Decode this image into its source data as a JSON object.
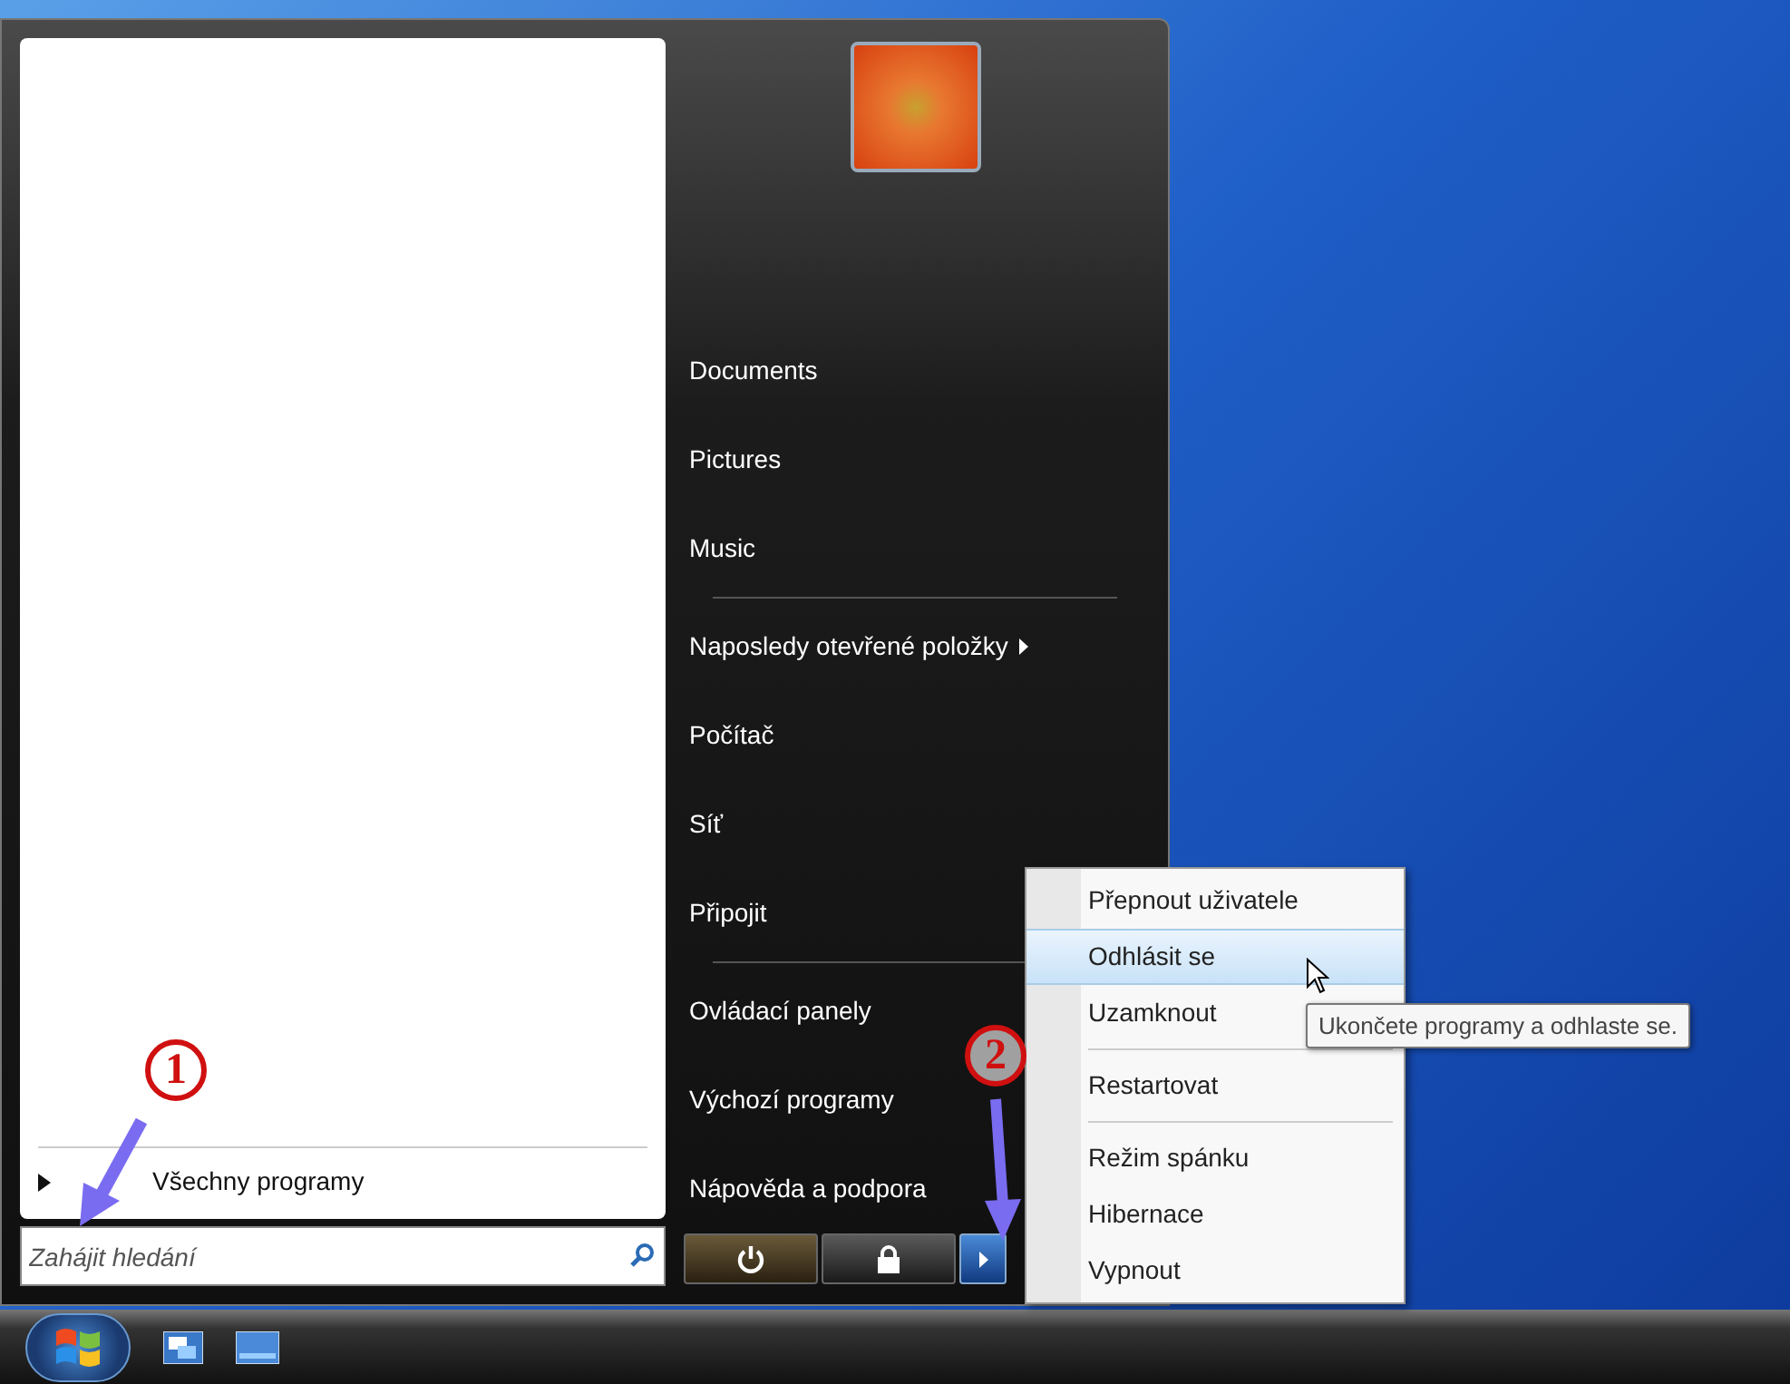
{
  "start_menu": {
    "all_programs": {
      "label": "Všechny programy"
    },
    "search": {
      "placeholder": "Zahájit hledání"
    },
    "places": [
      {
        "kind": "link",
        "label": "Documents"
      },
      {
        "kind": "link",
        "label": "Pictures"
      },
      {
        "kind": "link",
        "label": "Music"
      },
      {
        "kind": "separator"
      },
      {
        "kind": "submenu",
        "label": "Naposledy otevřené položky"
      },
      {
        "kind": "link",
        "label": "Počítač"
      },
      {
        "kind": "link",
        "label": "Síť"
      },
      {
        "kind": "link",
        "label": "Připojit"
      },
      {
        "kind": "separator"
      },
      {
        "kind": "link",
        "label": "Ovládací panely"
      },
      {
        "kind": "link",
        "label": "Výchozí programy"
      },
      {
        "kind": "link",
        "label": "Nápověda a podpora"
      }
    ],
    "power_buttons": [
      {
        "kind": "power",
        "selected": false
      },
      {
        "kind": "lock",
        "selected": false
      },
      {
        "kind": "arrow",
        "selected": true
      }
    ]
  },
  "power_menu": {
    "items": [
      {
        "kind": "item",
        "label": "Přepnout uživatele",
        "selected": false
      },
      {
        "kind": "item",
        "label": "Odhlásit se",
        "selected": true
      },
      {
        "kind": "item",
        "label": "Uzamknout",
        "selected": false
      },
      {
        "kind": "separator"
      },
      {
        "kind": "item",
        "label": "Restartovat",
        "selected": false
      },
      {
        "kind": "separator"
      },
      {
        "kind": "item",
        "label": "Režim spánku",
        "selected": false
      },
      {
        "kind": "item",
        "label": "Hibernace",
        "selected": false
      },
      {
        "kind": "item",
        "label": "Vypnout",
        "selected": false
      }
    ]
  },
  "tooltip": {
    "text": "Ukončete programy a odhlaste se."
  },
  "annotations": [
    {
      "number": "1"
    },
    {
      "number": "2"
    }
  ]
}
